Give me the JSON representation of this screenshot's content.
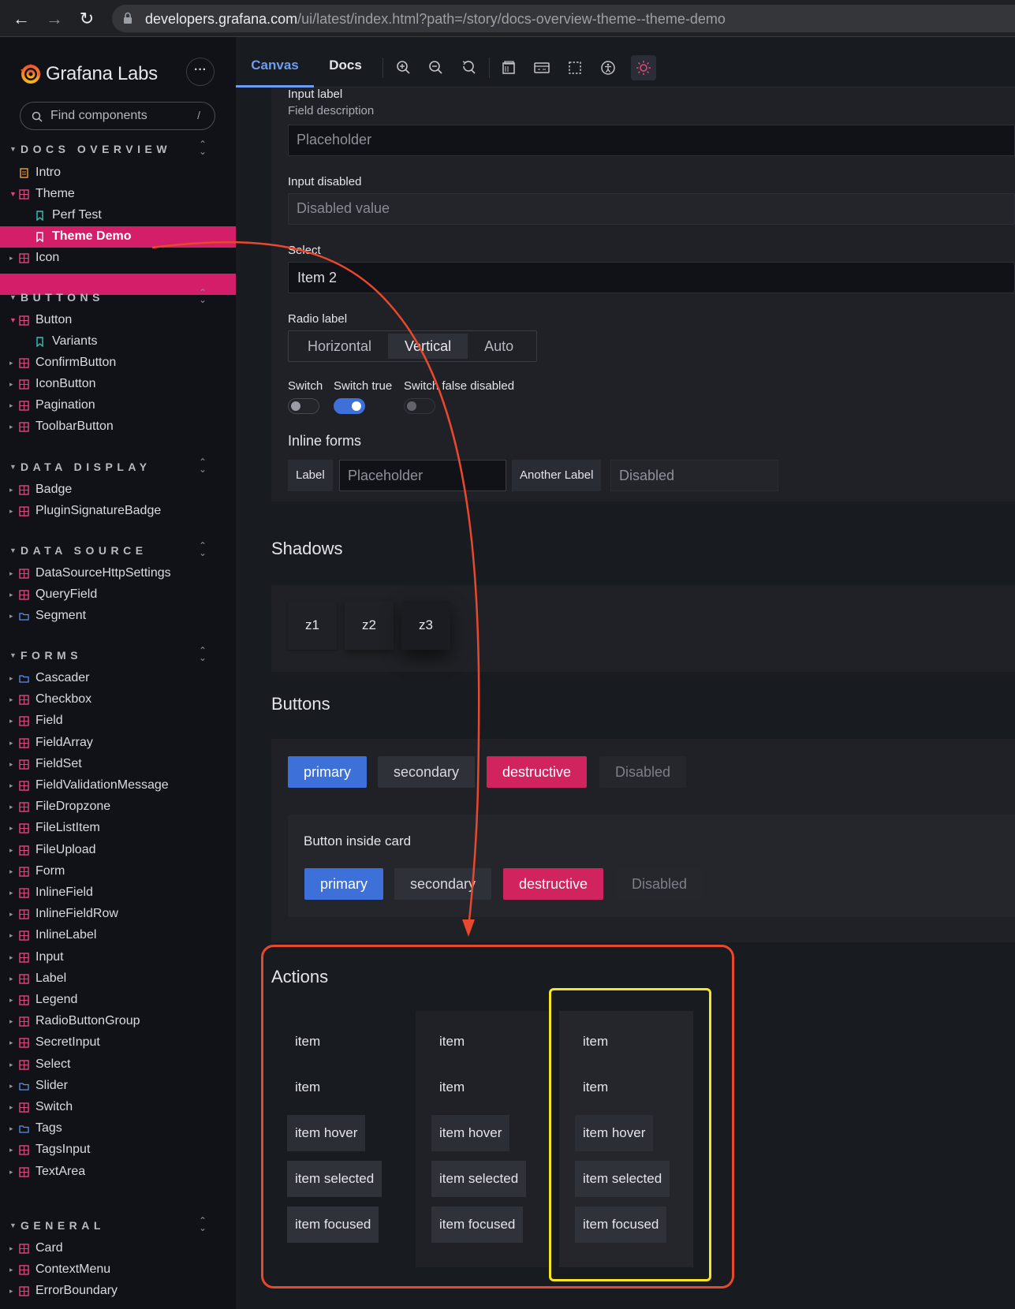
{
  "browser": {
    "url_host": "developers.grafana.com",
    "url_path": "/ui/latest/index.html?path=/story/docs-overview-theme--theme-demo"
  },
  "sidebar": {
    "brand": "Grafana Labs",
    "search_placeholder": "Find components",
    "search_shortcut": "/",
    "sections": {
      "docs_overview": "DOCS OVERVIEW",
      "buttons": "BUTTONS",
      "data_display": "DATA DISPLAY",
      "data_source": "DATA SOURCE",
      "forms": "FORMS",
      "general": "GENERAL"
    },
    "items": {
      "intro": "Intro",
      "theme": "Theme",
      "perf_test": "Perf Test",
      "theme_demo": "Theme Demo",
      "icon": "Icon",
      "button": "Button",
      "variants": "Variants",
      "confirm_button": "ConfirmButton",
      "icon_button": "IconButton",
      "pagination": "Pagination",
      "toolbar_button": "ToolbarButton",
      "badge": "Badge",
      "plugin_signature_badge": "PluginSignatureBadge",
      "ds_http_settings": "DataSourceHttpSettings",
      "query_field": "QueryField",
      "segment": "Segment",
      "cascader": "Cascader",
      "checkbox": "Checkbox",
      "field": "Field",
      "field_array": "FieldArray",
      "field_set": "FieldSet",
      "field_validation_message": "FieldValidationMessage",
      "file_dropzone": "FileDropzone",
      "file_list_item": "FileListItem",
      "file_upload": "FileUpload",
      "form": "Form",
      "inline_field": "InlineField",
      "inline_field_row": "InlineFieldRow",
      "inline_label": "InlineLabel",
      "input": "Input",
      "label": "Label",
      "legend": "Legend",
      "radio_button_group": "RadioButtonGroup",
      "secret_input": "SecretInput",
      "select": "Select",
      "slider": "Slider",
      "switch": "Switch",
      "tags": "Tags",
      "tags_input": "TagsInput",
      "text_area": "TextArea",
      "card": "Card",
      "context_menu": "ContextMenu",
      "error_boundary": "ErrorBoundary"
    }
  },
  "toolbar": {
    "tab_canvas": "Canvas",
    "tab_docs": "Docs"
  },
  "form": {
    "input_label": "Input label",
    "field_description": "Field description",
    "input_placeholder": "Placeholder",
    "input_disabled_label": "Input disabled",
    "disabled_value": "Disabled value",
    "select_label": "Select",
    "select_value": "Item 2",
    "radio_label": "Radio label",
    "radio_horizontal": "Horizontal",
    "radio_vertical": "Vertical",
    "radio_auto": "Auto",
    "switch": "Switch",
    "switch_true": "Switch true",
    "switch_false_disabled": "Switch false disabled",
    "inline_forms": "Inline forms",
    "inline_label": "Label",
    "inline_placeholder": "Placeholder",
    "inline_another_label": "Another Label",
    "inline_disabled": "Disabled"
  },
  "shadows": {
    "title": "Shadows",
    "z1": "z1",
    "z2": "z2",
    "z3": "z3"
  },
  "buttons": {
    "title": "Buttons",
    "primary": "primary",
    "secondary": "secondary",
    "destructive": "destructive",
    "disabled": "Disabled",
    "card_title": "Button inside card"
  },
  "actions": {
    "title": "Actions",
    "item": "item",
    "item_hover": "item hover",
    "item_selected": "item selected",
    "item_focused": "item focused"
  },
  "colors": {
    "accent_blue": "#3d71d9",
    "destructive": "#d1245f",
    "sidebar_active": "#d41e6a",
    "annotation_red": "#e8482b",
    "annotation_yellow": "#f5e61f"
  }
}
